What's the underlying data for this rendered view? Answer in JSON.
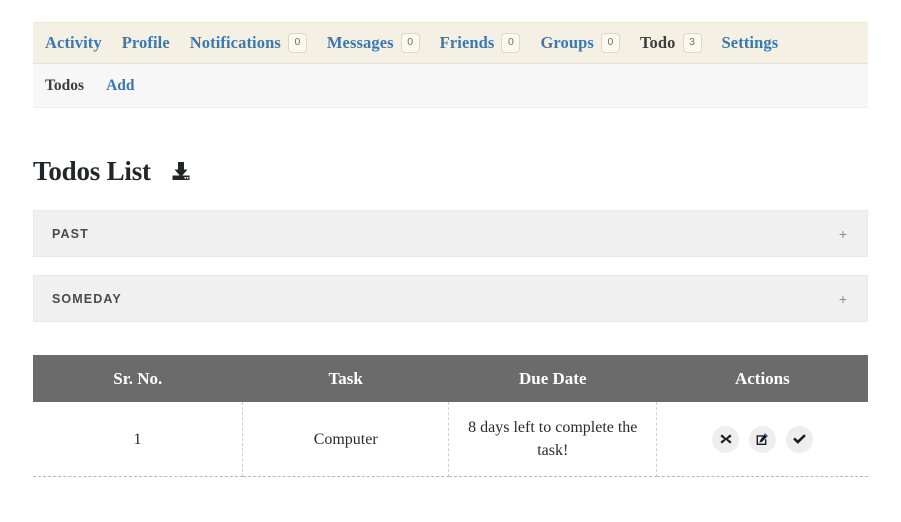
{
  "main_nav": {
    "items": [
      {
        "label": "Activity",
        "count": null,
        "current": false
      },
      {
        "label": "Profile",
        "count": null,
        "current": false
      },
      {
        "label": "Notifications",
        "count": "0",
        "current": false
      },
      {
        "label": "Messages",
        "count": "0",
        "current": false
      },
      {
        "label": "Friends",
        "count": "0",
        "current": false
      },
      {
        "label": "Groups",
        "count": "0",
        "current": false
      },
      {
        "label": "Todo",
        "count": "3",
        "current": true
      },
      {
        "label": "Settings",
        "count": null,
        "current": false
      }
    ]
  },
  "sub_nav": {
    "items": [
      {
        "label": "Todos",
        "current": true
      },
      {
        "label": "Add",
        "current": false
      }
    ]
  },
  "header": {
    "title": "Todos List",
    "export_icon": "download-icon"
  },
  "accordions": [
    {
      "label": "PAST",
      "toggle": "+"
    },
    {
      "label": "SOMEDAY",
      "toggle": "+"
    }
  ],
  "table": {
    "columns": [
      "Sr. No.",
      "Task",
      "Due Date",
      "Actions"
    ],
    "rows": [
      {
        "sr_no": "1",
        "task": "Computer",
        "due_date": "8 days left to complete the task!",
        "actions": [
          {
            "name": "delete-todo-button",
            "icon": "cross-icon"
          },
          {
            "name": "edit-todo-button",
            "icon": "edit-icon"
          },
          {
            "name": "complete-todo-button",
            "icon": "check-icon"
          }
        ]
      }
    ]
  },
  "colors": {
    "nav_background": "#f4f1e4",
    "link": "#3778b7",
    "table_header": "#6b6b6b",
    "accordion": "#f0f0f0"
  }
}
